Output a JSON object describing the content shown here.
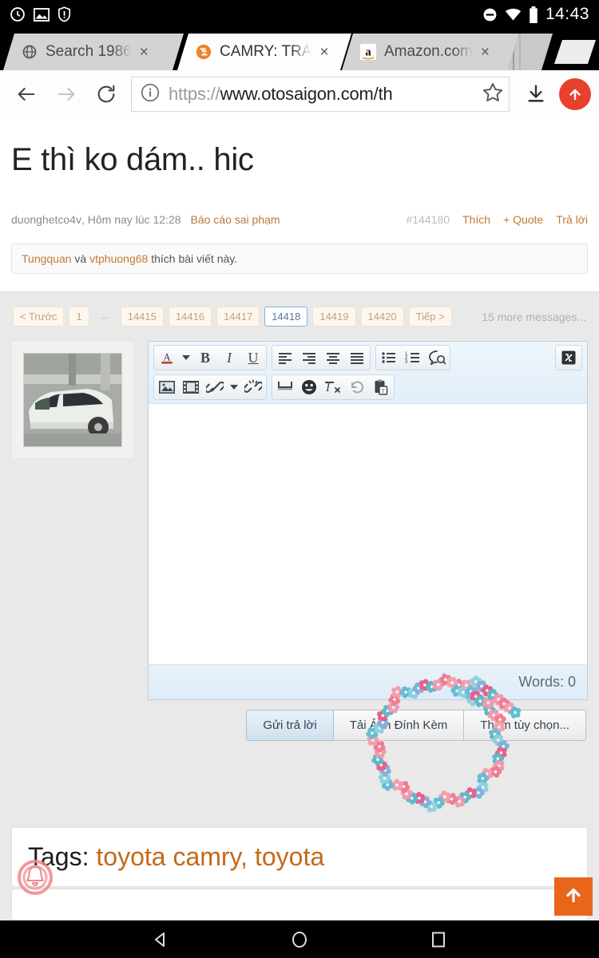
{
  "status_bar": {
    "left_icons": [
      "alarm-clock-icon",
      "screenshot-image-icon",
      "shield-warning-icon"
    ],
    "right_icons": [
      "do-not-disturb-icon",
      "wifi-icon",
      "battery-icon"
    ],
    "time": "14:43"
  },
  "browser": {
    "tabs": [
      {
        "title": "Search 1986",
        "favicon": "globe-icon",
        "close": "×",
        "active": false
      },
      {
        "title": "CAMRY: TRA",
        "favicon": "otosaigon-icon",
        "close": "×",
        "active": true
      },
      {
        "title": "Amazon.com",
        "favicon": "amazon-a-icon",
        "close": "×",
        "active": false
      }
    ],
    "toolbar": {
      "back": "back-arrow-icon",
      "forward": "forward-arrow-icon",
      "reload": "reload-icon",
      "page_info": "info-circle-icon",
      "url_scheme": "https://",
      "url_rest": "www.otosaigon.com/th",
      "bookmark": "star-icon",
      "download": "download-icon",
      "menu": "options-up-icon"
    }
  },
  "post": {
    "title": "E thì ko dám.. hic",
    "author": "duonghetco4v",
    "timestamp": "Hôm nay lúc 12:28",
    "report_label": "Báo cáo sai phạm",
    "post_number": "#144180",
    "actions": [
      "Thích",
      "+ Quote",
      "Trả lời"
    ],
    "like_line": {
      "user1": "Tungquan",
      "conjunction": " và ",
      "user2": "vtphuong68",
      "suffix": " thích bài viết này."
    }
  },
  "pagination": {
    "prev_label": "< Trước",
    "first_page": "1",
    "gap_icon": "ellipsis-arrow-icon",
    "pages": [
      "14415",
      "14416",
      "14417",
      "14418",
      "14419",
      "14420"
    ],
    "current_page": "14418",
    "next_label": "Tiếp >",
    "more_messages": "15 more messages..."
  },
  "editor": {
    "avatar_alt": "white-toyota-camry-thumbnail",
    "toolbar_row1": [
      {
        "name": "text-color-icon",
        "glyph": "A"
      },
      {
        "name": "text-color-dropdown-icon",
        "glyph": "▾"
      },
      {
        "name": "bold-icon",
        "glyph": "B"
      },
      {
        "name": "italic-icon",
        "glyph": "I"
      },
      {
        "name": "underline-icon",
        "glyph": "U"
      },
      {
        "name": "align-left-icon",
        "glyph": ""
      },
      {
        "name": "align-right-icon",
        "glyph": ""
      },
      {
        "name": "align-center-icon",
        "glyph": ""
      },
      {
        "name": "align-justify-icon",
        "glyph": ""
      },
      {
        "name": "bullet-list-icon",
        "glyph": ""
      },
      {
        "name": "numbered-list-icon",
        "glyph": ""
      },
      {
        "name": "quote-bubble-icon",
        "glyph": ""
      },
      {
        "name": "toggle-bbcode-icon",
        "glyph": ""
      }
    ],
    "toolbar_row2": [
      {
        "name": "insert-image-icon",
        "glyph": ""
      },
      {
        "name": "insert-video-icon",
        "glyph": ""
      },
      {
        "name": "insert-link-icon",
        "glyph": ""
      },
      {
        "name": "link-dropdown-icon",
        "glyph": "▾"
      },
      {
        "name": "unlink-icon",
        "glyph": ""
      },
      {
        "name": "horizontal-rule-icon",
        "glyph": ""
      },
      {
        "name": "emoji-icon",
        "glyph": ""
      },
      {
        "name": "remove-formatting-icon",
        "glyph": ""
      },
      {
        "name": "undo-icon",
        "glyph": ""
      },
      {
        "name": "paste-text-icon",
        "glyph": ""
      }
    ],
    "body_value": "",
    "body_placeholder": "",
    "word_count_label": "Words: 0",
    "buttons": {
      "submit": "Gửi trả lời",
      "upload": "Tải Ảnh Đính Kèm",
      "more_options": "Thêm tùy chọn..."
    }
  },
  "tags": {
    "label": "Tags:",
    "value": "toyota camry, toyota"
  },
  "annotations": {
    "flower_circle": "hand-drawn-flower-circle-highlight",
    "bell_marker": "pink-bell-marker"
  },
  "overlay": {
    "scroll_top_icon": "scroll-to-top-arrow-icon"
  },
  "android_nav": {
    "back": "nav-back-triangle-icon",
    "home": "nav-home-circle-icon",
    "recents": "nav-recents-square-icon"
  },
  "colors": {
    "accent_orange": "#c26a17",
    "link_orange": "#c07a35",
    "chrome_red": "#e8402a",
    "scroll_top": "#e8661a",
    "active_page_border": "#7fb2e0"
  }
}
